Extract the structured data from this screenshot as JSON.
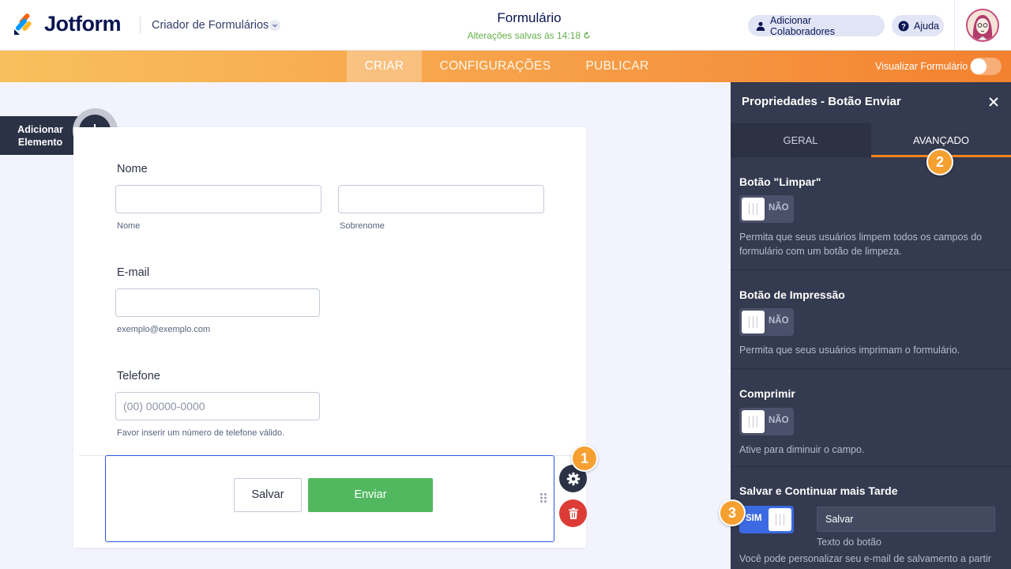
{
  "header": {
    "brand": "Jotform",
    "builder_title": "Criador de Formulários",
    "form_title": "Formulário",
    "save_status": "Alterações salvas às 14:18",
    "collab_button": "Adicionar Colaboradores",
    "help_button": "Ajuda"
  },
  "nav": {
    "tabs": [
      "CRIAR",
      "CONFIGURAÇÕES",
      "PUBLICAR"
    ],
    "preview_label": "Visualizar Formulário"
  },
  "add_element": {
    "label": "Adicionar Elemento"
  },
  "form": {
    "name": {
      "label": "Nome",
      "first_sublabel": "Nome",
      "last_sublabel": "Sobrenome"
    },
    "email": {
      "label": "E-mail",
      "sublabel": "exemplo@exemplo.com"
    },
    "phone": {
      "label": "Telefone",
      "placeholder": "(00) 00000-0000",
      "sublabel": "Favor inserir um número de telefone válido."
    },
    "save_button": "Salvar",
    "submit_button": "Enviar"
  },
  "badges": [
    "1",
    "2",
    "3"
  ],
  "panel": {
    "title": "Propriedades - Botão Enviar",
    "tabs": [
      "GERAL",
      "AVANÇADO"
    ],
    "sections": [
      {
        "title": "Botão \"Limpar\"",
        "toggle": "NÃO",
        "desc": "Permita que seus usuários limpem todos os campos do formulário com um botão de limpeza."
      },
      {
        "title": "Botão de Impressão",
        "toggle": "NÃO",
        "desc": "Permita que seus usuários imprimam o formulário."
      },
      {
        "title": "Comprimir",
        "toggle": "NÃO",
        "desc": "Ative para diminuir o campo."
      },
      {
        "title": "Salvar e Continuar mais Tarde",
        "toggle": "SIM",
        "text_value": "Salvar",
        "text_label": "Texto do botão",
        "desc": "Você pode personalizar seu e-mail de salvamento a partir"
      }
    ]
  },
  "colors": {
    "accent_orange": "#f6841c",
    "submit_green": "#52b860",
    "panel_bg": "#343a4f",
    "selection_blue": "#2a56e1",
    "delete_red": "#dc3c35"
  },
  "icons": [
    "jotform-logo-icon",
    "chevron-down-icon",
    "refresh-icon",
    "user-icon",
    "help-icon",
    "avatar-icon",
    "plus-icon",
    "gear-icon",
    "trash-icon",
    "drag-handle-icon",
    "close-icon"
  ]
}
